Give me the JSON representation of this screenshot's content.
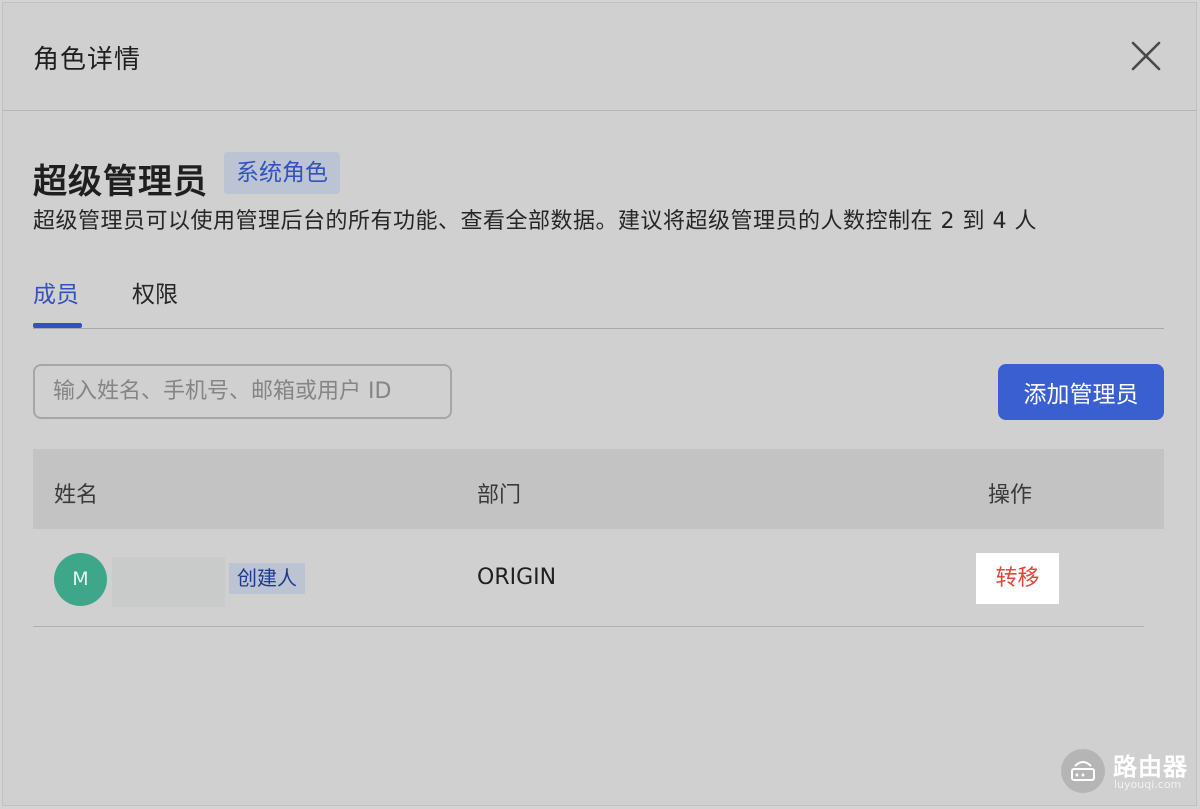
{
  "dialog": {
    "title": "角色详情",
    "close_icon": "close-icon"
  },
  "role": {
    "name": "超级管理员",
    "tag": "系统角色",
    "description": "超级管理员可以使用管理后台的所有功能、查看全部数据。建议将超级管理员的人数控制在 2 到 4 人"
  },
  "tabs": [
    {
      "label": "成员",
      "active": true
    },
    {
      "label": "权限",
      "active": false
    }
  ],
  "search": {
    "placeholder": "输入姓名、手机号、邮箱或用户 ID",
    "value": ""
  },
  "add_button": {
    "label": "添加管理员"
  },
  "table": {
    "columns": [
      "姓名",
      "部门",
      "操作"
    ],
    "rows": [
      {
        "avatar_initial": "M",
        "name": "",
        "badge": "创建人",
        "department": "ORIGIN",
        "action": "转移"
      }
    ]
  },
  "watermark": {
    "text": "路由器",
    "sub": "luyouqi.com"
  },
  "colors": {
    "accent": "#3352bf",
    "primary_button": "#3a5fd1",
    "danger": "#e0463a",
    "avatar": "#3fa789"
  }
}
